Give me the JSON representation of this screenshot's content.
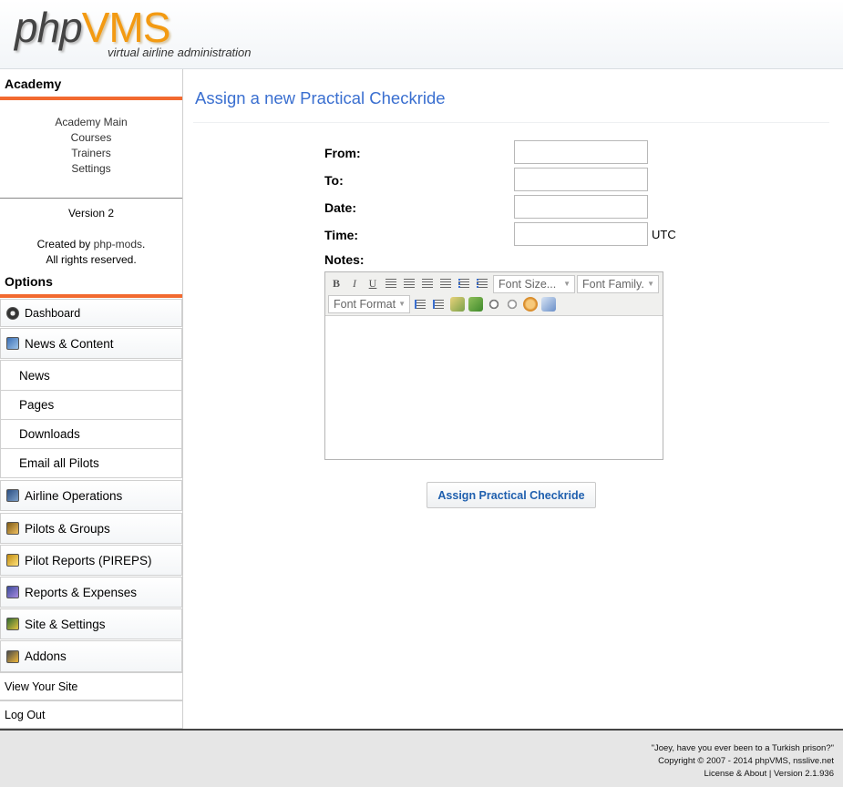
{
  "header": {
    "logo_php": "php",
    "logo_vms": "VMS",
    "logo_subtitle": "virtual airline administration"
  },
  "sidebar": {
    "academy_heading": "Academy",
    "academy_links": [
      "Academy Main",
      "Courses",
      "Trainers",
      "Settings"
    ],
    "version": "Version 2",
    "created_by_prefix": "Created by ",
    "created_by_link": "php-mods",
    "created_by_suffix": ".",
    "rights": "All rights reserved.",
    "options_heading": "Options",
    "menu": {
      "dashboard": "Dashboard",
      "news_content": "News & Content",
      "news": "News",
      "pages": "Pages",
      "downloads": "Downloads",
      "email_pilots": "Email all Pilots",
      "airline_ops": "Airline Operations",
      "pilots_groups": "Pilots & Groups",
      "pireps": "Pilot Reports (PIREPS)",
      "reports_expenses": "Reports & Expenses",
      "site_settings": "Site & Settings",
      "addons": "Addons",
      "view_site": "View Your Site",
      "logout": "Log Out"
    }
  },
  "main": {
    "title": "Assign a new Practical Checkride",
    "form": {
      "from_label": "From:",
      "to_label": "To:",
      "date_label": "Date:",
      "time_label": "Time:",
      "utc_label": "UTC",
      "notes_label": "Notes:",
      "from_value": "",
      "to_value": "",
      "date_value": "",
      "time_value": ""
    },
    "editor": {
      "bold": "B",
      "italic": "I",
      "underline": "U",
      "font_size": "Font Size...",
      "font_family": "Font Family.",
      "font_format": "Font Format"
    },
    "submit_label": "Assign Practical Checkride"
  },
  "footer": {
    "quote": "\"Joey, have you ever been to a Turkish prison?\"",
    "copyright_prefix": "Copyright © 2007 - 2014 ",
    "phpvms_link": "phpVMS",
    "copyright_suffix": ", nsslive.net",
    "license_link": "License & About",
    "separator": " | ",
    "version": "Version 2.1.936"
  }
}
